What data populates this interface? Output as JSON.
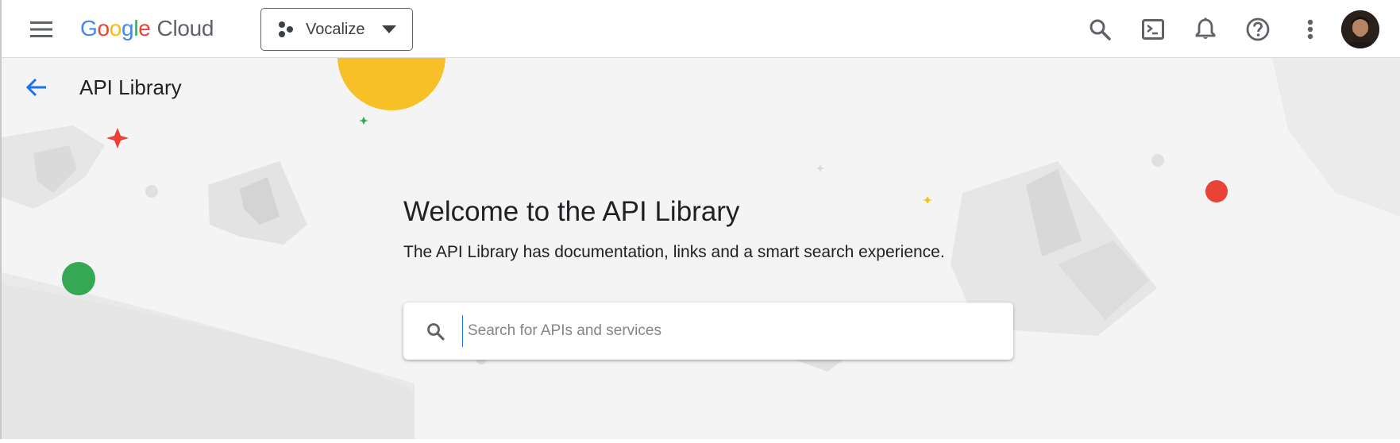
{
  "header": {
    "brand": {
      "google_letters": [
        {
          "ch": "G",
          "color": "#4285F4"
        },
        {
          "ch": "o",
          "color": "#EA4335"
        },
        {
          "ch": "o",
          "color": "#FBBC04"
        },
        {
          "ch": "g",
          "color": "#4285F4"
        },
        {
          "ch": "l",
          "color": "#34A853"
        },
        {
          "ch": "e",
          "color": "#EA4335"
        }
      ],
      "product": "Cloud"
    },
    "project": {
      "name": "Vocalize"
    },
    "icons": [
      "menu-icon",
      "project-icon",
      "search-icon",
      "cloud-shell-icon",
      "notifications-icon",
      "help-icon",
      "more-vert-icon",
      "account-avatar"
    ]
  },
  "page": {
    "title": "API Library",
    "welcome_heading": "Welcome to the API Library",
    "welcome_subtitle": "The API Library has documentation, links and a smart search experience."
  },
  "search": {
    "placeholder": "Search for APIs and services",
    "value": ""
  },
  "colors": {
    "accent_blue": "#1a73e8",
    "background": "#f4f4f4",
    "decor_yellow": "#f6c026",
    "decor_red": "#ea4335",
    "decor_green": "#34a853"
  }
}
